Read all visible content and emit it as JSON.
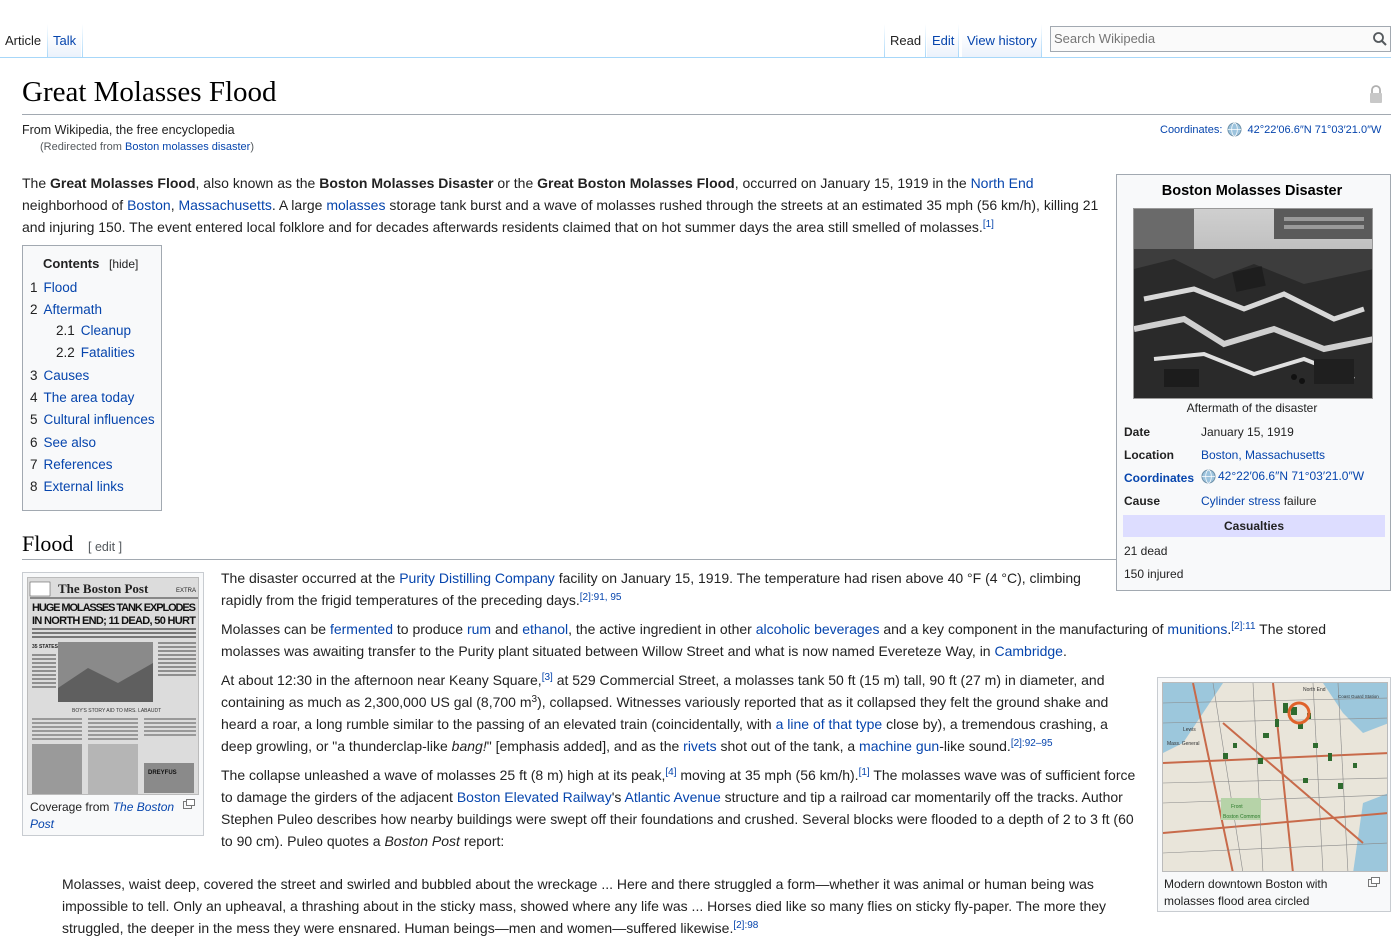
{
  "tabs": {
    "article": "Article",
    "talk": "Talk",
    "read": "Read",
    "edit": "Edit",
    "view_history": "View history"
  },
  "search": {
    "placeholder": "Search Wikipedia"
  },
  "page": {
    "title": "Great Molasses Flood",
    "tagline": "From Wikipedia, the free encyclopedia",
    "redirect_prefix": "(Redirected from ",
    "redirect_link": "Boston molasses disaster",
    "redirect_suffix": ")",
    "coords_label": "Coordinates:",
    "coords_value": "42°22′06.6″N 71°03′21.0″W"
  },
  "intro": {
    "t1": "The ",
    "b1": "Great Molasses Flood",
    "t2": ", also known as the ",
    "b2": "Boston Molasses Disaster",
    "t3": " or the ",
    "b3": "Great Boston Molasses Flood",
    "t4": ", occurred on January 15, 1919 in the ",
    "l_north_end": "North End",
    "t5": " neighborhood of ",
    "l_boston": "Boston",
    "t6": ", ",
    "l_mass": "Massachusetts",
    "t7": ". A large ",
    "l_molasses": "molasses",
    "t8": " storage tank burst and a wave of molasses rushed through the streets at an estimated 35 mph (56 km/h), killing 21 and injuring 150. The event entered local folklore and for decades afterwards residents claimed that on hot summer days the area still smelled of molasses.",
    "ref1": "[1]"
  },
  "toc": {
    "title": "Contents",
    "hide": "[hide]",
    "items": [
      {
        "num": "1",
        "label": "Flood"
      },
      {
        "num": "2",
        "label": "Aftermath"
      },
      {
        "num": "2.1",
        "label": "Cleanup"
      },
      {
        "num": "2.2",
        "label": "Fatalities"
      },
      {
        "num": "3",
        "label": "Causes"
      },
      {
        "num": "4",
        "label": "The area today"
      },
      {
        "num": "5",
        "label": "Cultural influences"
      },
      {
        "num": "6",
        "label": "See also"
      },
      {
        "num": "7",
        "label": "References"
      },
      {
        "num": "8",
        "label": "External links"
      }
    ]
  },
  "flood": {
    "heading": "Flood",
    "edit": "[ edit ]",
    "p1_t1": "The disaster occurred at the ",
    "p1_l1": "Purity Distilling Company",
    "p1_t2": " facility on January 15, 1919. The temperature had risen above 40 °F (4 °C), climbing rapidly from the frigid temperatures of the preceding days.",
    "p1_ref": "[2]:91, 95",
    "p2_t1": "Molasses can be ",
    "p2_l1": "fermented",
    "p2_t2": " to produce ",
    "p2_l2": "rum",
    "p2_t3": " and ",
    "p2_l3": "ethanol",
    "p2_t4": ", the active ingredient in other ",
    "p2_l4": "alcoholic beverages",
    "p2_t5": " and a key component in the manufacturing of ",
    "p2_l5": "munitions",
    "p2_t6": ".",
    "p2_ref": "[2]:11",
    "p2_t7": " The stored molasses was awaiting transfer to the Purity plant situated between Willow Street and what is now named Evereteze Way, in ",
    "p2_l6": "Cambridge",
    "p2_t8": ".",
    "p3_t1": "At about 12:30 in the afternoon near Keany Square,",
    "p3_ref1": "[3]",
    "p3_t2": " at 529 Commercial Street, a molasses tank 50 ft (15 m) tall, 90 ft (27 m) in diameter, and containing as much as 2,300,000 US gal (8,700 m",
    "p3_sup": "3",
    "p3_t3": "), collapsed. Witnesses variously reported that as it collapsed they felt the ground shake and heard a roar, a long rumble similar to the passing of an elevated train (coincidentally, with ",
    "p3_l1": "a line of that type",
    "p3_t4": " close by), a tremendous crashing, a deep growling, or \"a thunderclap-like ",
    "p3_i1": "bang!",
    "p3_t5": "\" [emphasis added], and as the ",
    "p3_l2": "rivets",
    "p3_t6": " shot out of the tank, a ",
    "p3_l3": "machine gun",
    "p3_t7": "-like sound.",
    "p3_ref2": "[2]:92–95",
    "p4_t1": "The collapse unleashed a wave of molasses 25 ft (8 m) high at its peak,",
    "p4_ref1": "[4]",
    "p4_t2": " moving at 35 mph (56 km/h).",
    "p4_ref2": "[1]",
    "p4_t3": " The molasses wave was of sufficient force to damage the girders of the adjacent ",
    "p4_l1": "Boston Elevated Railway",
    "p4_t4": "'s ",
    "p4_l2": "Atlantic Avenue",
    "p4_t5": " structure and tip a railroad car momentarily off the tracks. Author Stephen Puleo describes how nearby buildings were swept off their foundations and crushed. Several blocks were flooded to a depth of 2 to 3 ft (60 to 90 cm). Puleo quotes a ",
    "p4_i1": "Boston Post",
    "p4_t6": " report:",
    "quote": "Molasses, waist deep, covered the street and swirled and bubbled about the wreckage ... Here and there struggled a form—whether it was animal or human being was impossible to tell. Only an upheaval, a thrashing about in the sticky mass, showed where any life was ... Horses died like so many flies on sticky fly-paper. The more they struggled, the deeper in the mess they were ensnared. Human beings—men and women—suffered likewise.",
    "quote_ref": "[2]:98"
  },
  "thumb_left": {
    "caption_t1": "Coverage from ",
    "caption_l1": "The Boston Post",
    "paper": {
      "masthead": "The Boston Post",
      "extra": "EXTRA",
      "headline1": "HUGE MOLASSES TANK EXPLODES",
      "headline2": "IN NORTH END; 11 DEAD, 50 HURT",
      "side": "35 STATES ON DRY LAW LIST",
      "boys": "BOY'S STORY AID TO MRS. LABAUDT",
      "ad": "DREYFUS"
    }
  },
  "infobox": {
    "title": "Boston Molasses Disaster",
    "photo_caption": "Aftermath of the disaster",
    "rows": [
      {
        "label": "Date",
        "value": "January 15, 1919"
      },
      {
        "label": "Location",
        "value": "Boston, Massachusetts"
      },
      {
        "label": "Coordinates",
        "value": "42°22′06.6″N 71°03′21.0″W"
      },
      {
        "label": "Cause",
        "value_link": "Cylinder stress",
        "value_rest": " failure"
      }
    ],
    "casualties_header": "Casualties",
    "casualties": [
      "21 dead",
      "150 injured"
    ]
  },
  "map": {
    "caption": "Modern downtown Boston with molasses flood area circled",
    "labels": {
      "north_end": "North End",
      "coast_guard": "Coast Guard Station",
      "mass_gen": "Mass. General",
      "lewis": "Lewis",
      "front": "Front",
      "boston_common": "Boston Common"
    }
  },
  "colors": {
    "link": "#0645ad",
    "text": "#222222",
    "border": "#a2a9b1",
    "infobox_bg": "#f8f9fa",
    "casualties_bg": "#ddddff",
    "tab_border": "#a7d7f9"
  }
}
